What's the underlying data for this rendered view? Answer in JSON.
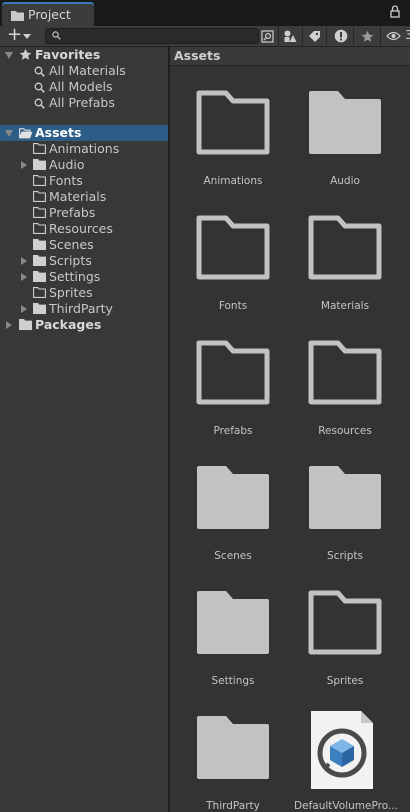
{
  "window": {
    "tab_title": "Project",
    "tab_icon": "folder-icon"
  },
  "toolbar": {
    "add_label": "+",
    "search": {
      "value": "",
      "placeholder": ""
    },
    "hidden_count": "3"
  },
  "tree": {
    "favorites": {
      "label": "Favorites",
      "items": [
        "All Materials",
        "All Models",
        "All Prefabs"
      ]
    },
    "assets": {
      "label": "Assets",
      "children": [
        {
          "label": "Animations",
          "expandable": false
        },
        {
          "label": "Audio",
          "expandable": true
        },
        {
          "label": "Fonts",
          "expandable": false
        },
        {
          "label": "Materials",
          "expandable": false
        },
        {
          "label": "Prefabs",
          "expandable": false
        },
        {
          "label": "Resources",
          "expandable": false
        },
        {
          "label": "Scenes",
          "expandable": false
        },
        {
          "label": "Scripts",
          "expandable": true
        },
        {
          "label": "Settings",
          "expandable": true
        },
        {
          "label": "Sprites",
          "expandable": false
        },
        {
          "label": "ThirdParty",
          "expandable": true
        }
      ]
    },
    "packages": {
      "label": "Packages"
    }
  },
  "grid": {
    "header": "Assets",
    "items": [
      {
        "name": "Animations",
        "kind": "folder-empty"
      },
      {
        "name": "Audio",
        "kind": "folder-filled"
      },
      {
        "name": "Fonts",
        "kind": "folder-empty"
      },
      {
        "name": "Materials",
        "kind": "folder-empty"
      },
      {
        "name": "Prefabs",
        "kind": "folder-empty"
      },
      {
        "name": "Resources",
        "kind": "folder-empty"
      },
      {
        "name": "Scenes",
        "kind": "folder-filled"
      },
      {
        "name": "Scripts",
        "kind": "folder-filled"
      },
      {
        "name": "Settings",
        "kind": "folder-filled"
      },
      {
        "name": "Sprites",
        "kind": "folder-empty"
      },
      {
        "name": "ThirdParty",
        "kind": "folder-filled"
      },
      {
        "name": "DefaultVolumePro...",
        "kind": "asset-file"
      }
    ]
  },
  "colors": {
    "selection": "#2c5d87",
    "tab_accent": "#3a79bb",
    "folder": "#c2c2c2"
  }
}
